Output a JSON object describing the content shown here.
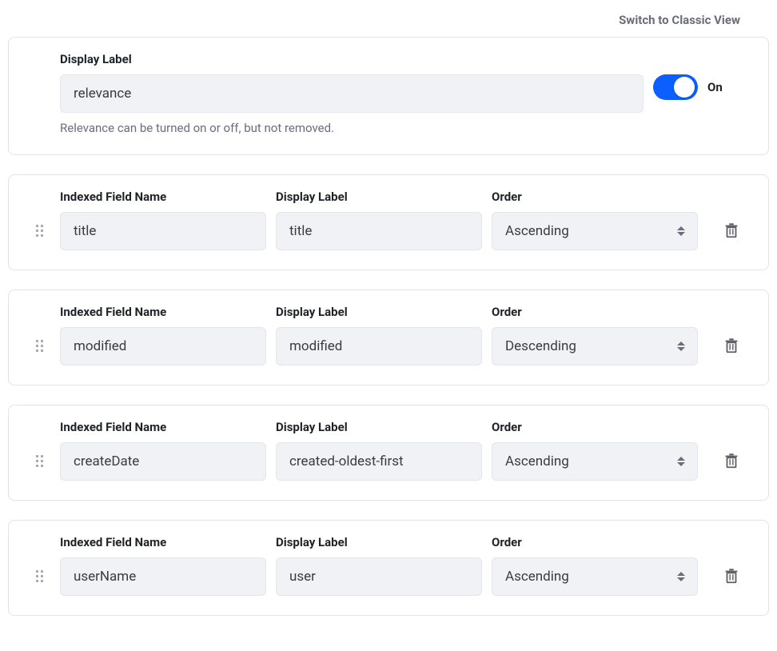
{
  "header": {
    "switch_link": "Switch to Classic View"
  },
  "labels": {
    "indexed_field": "Indexed Field Name",
    "display_label": "Display Label",
    "order": "Order"
  },
  "relevance": {
    "value": "relevance",
    "helper": "Relevance can be turned on or off, but not removed.",
    "toggle_state": "On"
  },
  "rows": [
    {
      "field": "title",
      "label": "title",
      "order": "Ascending"
    },
    {
      "field": "modified",
      "label": "modified",
      "order": "Descending"
    },
    {
      "field": "createDate",
      "label": "created-oldest-first",
      "order": "Ascending"
    },
    {
      "field": "userName",
      "label": "user",
      "order": "Ascending"
    }
  ]
}
